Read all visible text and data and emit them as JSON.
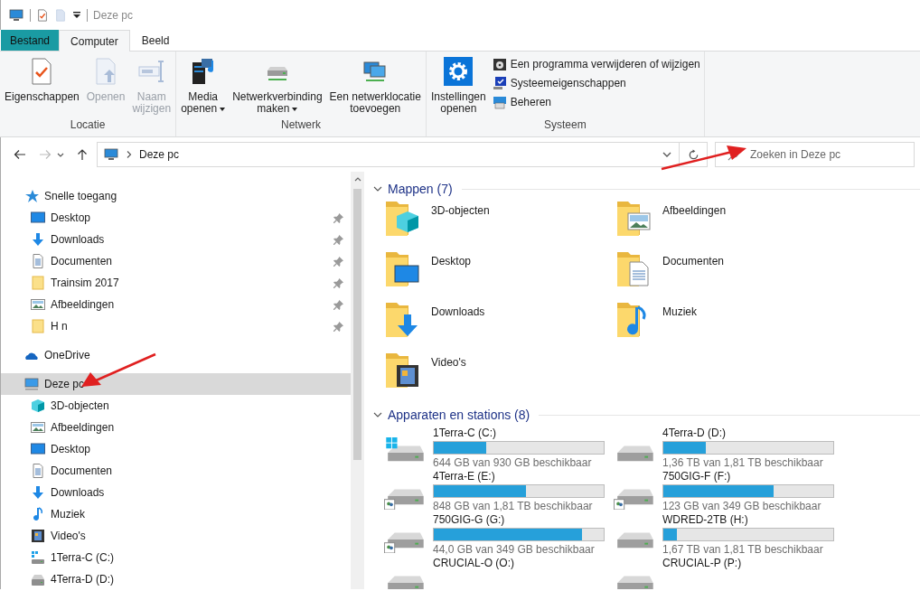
{
  "window": {
    "title": "Deze pc"
  },
  "ribbon_tabs": [
    {
      "label": "Bestand",
      "kind": "file",
      "selected": false
    },
    {
      "label": "Computer",
      "kind": "tab",
      "selected": true
    },
    {
      "label": "Beeld",
      "kind": "tab",
      "selected": false
    }
  ],
  "ribbon_groups": [
    {
      "label": "Locatie",
      "buttons": [
        {
          "kind": "properties",
          "lines": [
            "Eigenschappen"
          ],
          "disabled": false,
          "dropdown": false
        },
        {
          "kind": "open",
          "lines": [
            "Openen"
          ],
          "disabled": true,
          "dropdown": false
        },
        {
          "kind": "rename",
          "lines": [
            "Naam",
            "wijzigen"
          ],
          "disabled": true,
          "dropdown": false
        }
      ]
    },
    {
      "label": "Netwerk",
      "buttons": [
        {
          "kind": "media",
          "lines": [
            "Media",
            "openen"
          ],
          "disabled": false,
          "dropdown": true
        },
        {
          "kind": "network-drive",
          "lines": [
            "Netwerkverbinding",
            "maken"
          ],
          "disabled": false,
          "dropdown": true
        },
        {
          "kind": "network-location",
          "lines": [
            "Een netwerklocatie",
            "toevoegen"
          ],
          "disabled": false,
          "dropdown": false
        }
      ]
    },
    {
      "label": "Systeem",
      "buttons": [
        {
          "kind": "settings",
          "lines": [
            "Instellingen",
            "openen"
          ],
          "disabled": false,
          "dropdown": false
        }
      ],
      "small_buttons": [
        {
          "kind": "uninstall",
          "label": "Een programma verwijderen of wijzigen"
        },
        {
          "kind": "system-properties",
          "label": "Systeemeigenschappen"
        },
        {
          "kind": "manage",
          "label": "Beheren"
        }
      ]
    }
  ],
  "address_bar": {
    "location": "Deze pc"
  },
  "search": {
    "placeholder": "Zoeken in Deze pc"
  },
  "navigation": [
    {
      "label": "Snelle toegang",
      "kind": "star",
      "selected": false,
      "children": [
        {
          "label": "Desktop",
          "kind": "desktop",
          "pinned": true
        },
        {
          "label": "Downloads",
          "kind": "download",
          "pinned": true
        },
        {
          "label": "Documenten",
          "kind": "document",
          "pinned": true
        },
        {
          "label": "Trainsim 2017",
          "kind": "folder",
          "pinned": true
        },
        {
          "label": "Afbeeldingen",
          "kind": "pictures",
          "pinned": true
        },
        {
          "label": "H   n",
          "kind": "folder",
          "pinned": true
        }
      ]
    },
    {
      "label": "OneDrive",
      "kind": "cloud",
      "selected": false
    },
    {
      "label": "Deze pc",
      "kind": "pc",
      "selected": true,
      "children": [
        {
          "label": "3D-objecten",
          "kind": "cube",
          "pinned": false
        },
        {
          "label": "Afbeeldingen",
          "kind": "pictures",
          "pinned": false
        },
        {
          "label": "Desktop",
          "kind": "desktop",
          "pinned": false
        },
        {
          "label": "Documenten",
          "kind": "document",
          "pinned": false
        },
        {
          "label": "Downloads",
          "kind": "download",
          "pinned": false
        },
        {
          "label": "Muziek",
          "kind": "music",
          "pinned": false
        },
        {
          "label": "Video's",
          "kind": "video",
          "pinned": false
        },
        {
          "label": "1Terra-C (C:)",
          "kind": "drive-system",
          "pinned": false
        },
        {
          "label": "4Terra-D (D:)",
          "kind": "drive",
          "pinned": false
        }
      ]
    }
  ],
  "sections": [
    {
      "title": "Mappen (7)",
      "kind": "folders",
      "expanded": true,
      "items": [
        {
          "name": "3D-objecten",
          "kind": "cube"
        },
        {
          "name": "Afbeeldingen",
          "kind": "pictures"
        },
        {
          "name": "Desktop",
          "kind": "desktop"
        },
        {
          "name": "Documenten",
          "kind": "document"
        },
        {
          "name": "Downloads",
          "kind": "download"
        },
        {
          "name": "Muziek",
          "kind": "music"
        },
        {
          "name": "Video's",
          "kind": "video"
        }
      ]
    },
    {
      "title": "Apparaten en stations (8)",
      "kind": "drives",
      "expanded": true,
      "items": [
        {
          "name": "1Terra-C (C:)",
          "kind": "system",
          "level": 0.31,
          "free": "644 GB van 930 GB beschikbaar"
        },
        {
          "name": "4Terra-D (D:)",
          "kind": "local",
          "level": 0.25,
          "free": "1,36 TB van 1,81 TB beschikbaar"
        },
        {
          "name": "4Terra-E (E:)",
          "kind": "shared",
          "level": 0.54,
          "free": "848 GB van 1,81 TB beschikbaar"
        },
        {
          "name": "750GIG-F (F:)",
          "kind": "shared",
          "level": 0.65,
          "free": "123 GB van 349 GB beschikbaar"
        },
        {
          "name": "750GIG-G (G:)",
          "kind": "shared",
          "level": 0.87,
          "free": "44,0 GB van 349 GB beschikbaar"
        },
        {
          "name": "WDRED-2TB (H:)",
          "kind": "local",
          "level": 0.08,
          "free": "1,67 TB van 1,81 TB beschikbaar"
        },
        {
          "name": "CRUCIAL-O (O:)",
          "kind": "local"
        },
        {
          "name": "CRUCIAL-P (P:)",
          "kind": "local"
        }
      ]
    }
  ]
}
